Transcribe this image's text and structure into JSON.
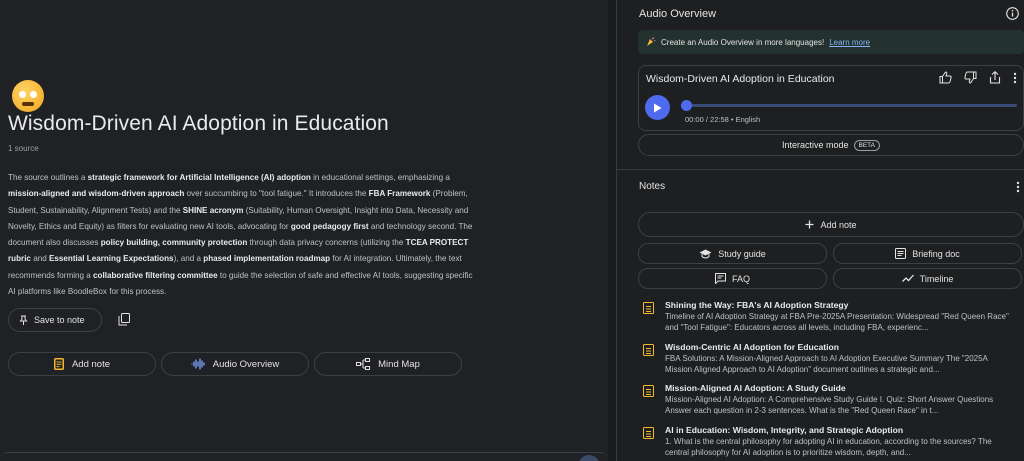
{
  "notebook": {
    "title": "Wisdom-Driven AI Adoption in Education",
    "source_count": "1 source",
    "summary": [
      {
        "t": "The source outlines a ",
        "b": false
      },
      {
        "t": "strategic framework for Artificial Intelligence (AI) adoption",
        "b": true
      },
      {
        "t": " in educational settings, emphasizing a ",
        "b": false
      },
      {
        "t": "mission-aligned and wisdom-driven approach",
        "b": true
      },
      {
        "t": " over succumbing to \"tool fatigue.\" It introduces the ",
        "b": false
      },
      {
        "t": "FBA Framework",
        "b": true
      },
      {
        "t": " (Problem, Student, Sustainability, Alignment Tests) and the ",
        "b": false
      },
      {
        "t": "SHINE acronym",
        "b": true
      },
      {
        "t": " (Suitability, Human Oversight, Insight into Data, Necessity and Novelty, Ethics and Equity) as filters for evaluating new AI tools, advocating for ",
        "b": false
      },
      {
        "t": "good pedagogy first",
        "b": true
      },
      {
        "t": " and technology second. The document also discusses ",
        "b": false
      },
      {
        "t": "policy building, community protection",
        "b": true
      },
      {
        "t": " through data privacy concerns (utilizing the ",
        "b": false
      },
      {
        "t": "TCEA PROTECT rubric",
        "b": true
      },
      {
        "t": " and ",
        "b": false
      },
      {
        "t": "Essential Learning Expectations",
        "b": true
      },
      {
        "t": "), and a ",
        "b": false
      },
      {
        "t": "phased implementation roadmap",
        "b": true
      },
      {
        "t": " for AI integration. Ultimately, the text recommends forming a ",
        "b": false
      },
      {
        "t": "collaborative filtering committee",
        "b": true
      },
      {
        "t": " to guide the selection of safe and effective AI tools, suggesting specific AI platforms like BoodleBox for this process.",
        "b": false
      }
    ],
    "save_note_label": "Save to note",
    "actions": {
      "add_note": "Add note",
      "audio_overview": "Audio Overview",
      "mind_map": "Mind Map"
    }
  },
  "audio_panel": {
    "header": "Audio Overview",
    "banner_text": "Create an Audio Overview in more languages!",
    "banner_link": "Learn more",
    "card_title": "Wisdom-Driven AI Adoption in Education",
    "progress": 0.0,
    "time": "00:00 / 22:58 • English",
    "interactive_label": "Interactive mode",
    "beta_label": "BETA"
  },
  "notes_panel": {
    "header": "Notes",
    "add_note": "Add note",
    "chips": {
      "study_guide": "Study guide",
      "briefing_doc": "Briefing doc",
      "faq": "FAQ",
      "timeline": "Timeline"
    },
    "items": [
      {
        "title": "Shining the Way: FBA's AI Adoption Strategy",
        "snippet": "Timeline of AI Adoption Strategy at FBA Pre-2025A Presentation: Widespread \"Red Queen Race\" and \"Tool Fatigue\": Educators across all levels, including FBA, experienc..."
      },
      {
        "title": "Wisdom-Centric AI Adoption for Education",
        "snippet": "FBA Solutions: A Mission-Aligned Approach to AI Adoption Executive Summary The \"2025A Mission Aligned Approach to AI Adoption\" document outlines a strategic and..."
      },
      {
        "title": "Mission-Aligned AI Adoption: A Study Guide",
        "snippet": "Mission-Aligned AI Adoption: A Comprehensive Study Guide I. Quiz: Short Answer Questions Answer each question in 2-3 sentences. What is the \"Red Queen Race\" in t..."
      },
      {
        "title": "AI in Education: Wisdom, Integrity, and Strategic Adoption",
        "snippet": "1. What is the central philosophy for adopting AI in education, according to the sources? The central philosophy for AI adoption is to prioritize wisdom, depth, and..."
      }
    ]
  }
}
